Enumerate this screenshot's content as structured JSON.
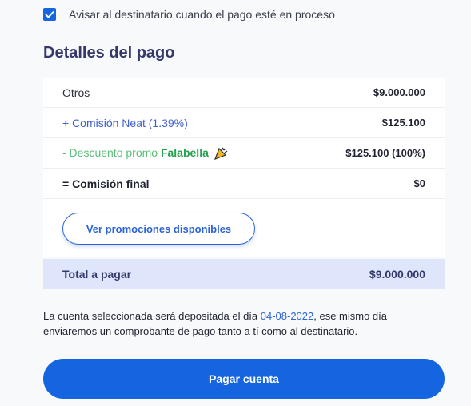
{
  "notify": {
    "checked": true,
    "label": "Avisar al destinatario cuando el pago esté en proceso"
  },
  "details": {
    "title": "Detalles del pago",
    "rows": [
      {
        "label": "Otros",
        "amount": "$9.000.000"
      },
      {
        "label": "+ Comisión Neat (1.39%)",
        "amount": "$125.100"
      },
      {
        "label_prefix": "- Descuento promo ",
        "brand": "Falabella",
        "icon": "party-tag-icon",
        "amount": "$125.100 (100%)"
      },
      {
        "label": "= Comisión final",
        "amount": "$0"
      }
    ],
    "promo_button": "Ver promociones disponibles"
  },
  "total": {
    "label": "Total a pagar",
    "amount": "$9.000.000"
  },
  "info": {
    "before": "La cuenta seleccionada será depositada el día ",
    "date": "04-08-2022",
    "after": ", ese mismo día enviaremos un comprobante de pago tanto a tí como al destinatario."
  },
  "pay_button": "Pagar cuenta",
  "colors": {
    "primary": "#1565e0",
    "title": "#33396b",
    "commission": "#3d5fcf",
    "discount": "#5bbf7a",
    "total_bg": "#dfe6fb"
  }
}
